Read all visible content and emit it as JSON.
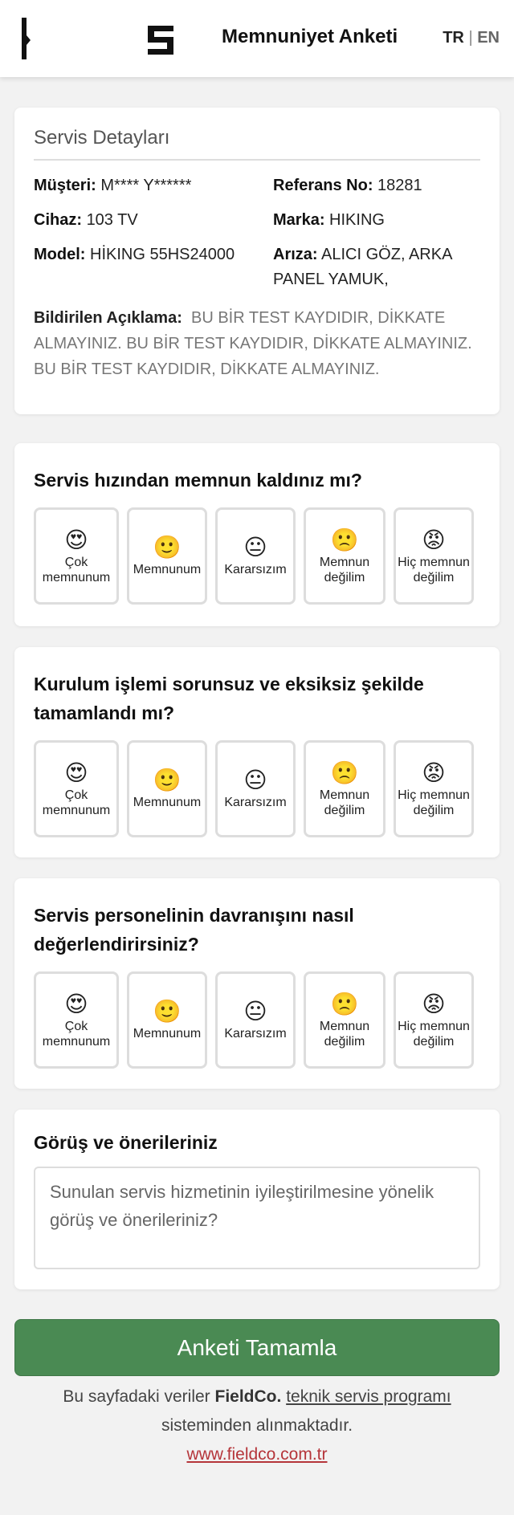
{
  "header": {
    "title": "Memnuniyet Anketi",
    "lang_tr": "TR",
    "lang_sep": "|",
    "lang_en": "EN"
  },
  "details": {
    "title": "Servis Detayları",
    "customer_label": "Müşteri:",
    "customer_value": "M**** Y******",
    "ref_label": "Referans No:",
    "ref_value": "18281",
    "device_label": "Cihaz:",
    "device_value": "103 TV",
    "brand_label": "Marka:",
    "brand_value": "HIKING",
    "model_label": "Model:",
    "model_value": "HİKING 55HS24000",
    "fault_label": "Arıza:",
    "fault_value": "ALICI GÖZ, ARKA PANEL YAMUK,",
    "desc_label": "Bildirilen Açıklama:",
    "desc_value": "BU BİR TEST KAYDIDIR, DİKKATE ALMAYINIZ. BU BİR TEST KAYDIDIR, DİKKATE ALMAYINIZ. BU BİR TEST KAYDIDIR, DİKKATE ALMAYINIZ."
  },
  "options": [
    {
      "emoji": "😍",
      "label": "Çok memnunum",
      "icon": "heart-eyes-emoji"
    },
    {
      "emoji": "🙂",
      "label": "Memnunum",
      "icon": "smile-emoji"
    },
    {
      "emoji": "😐",
      "label": "Kararsızım",
      "icon": "neutral-emoji"
    },
    {
      "emoji": "🙁",
      "label": "Memnun değilim",
      "icon": "frown-emoji"
    },
    {
      "emoji": "😡",
      "label": "Hiç memnun değilim",
      "icon": "angry-emoji"
    }
  ],
  "questions": [
    {
      "text": "Servis hızından memnun kaldınız mı?"
    },
    {
      "text": "Kurulum işlemi sorunsuz ve eksiksiz şekilde tamamlandı mı?"
    },
    {
      "text": "Servis personelinin davranışını nasıl değerlendirirsiniz?"
    }
  ],
  "feedback": {
    "title": "Görüş ve önerileriniz",
    "placeholder": "Sunulan servis hizmetinin iyileştirilmesine yönelik görüş ve önerileriniz?"
  },
  "submit_label": "Anketi Tamamla",
  "footer": {
    "text1": "Bu sayfadaki veriler",
    "brand": "FieldCo.",
    "link": "teknik servis programı",
    "text2": "sisteminden alınmaktadır.",
    "url": "www.fieldco.com.tr"
  },
  "colors": {
    "accent": "#4a8a53",
    "link": "#b5353a"
  }
}
